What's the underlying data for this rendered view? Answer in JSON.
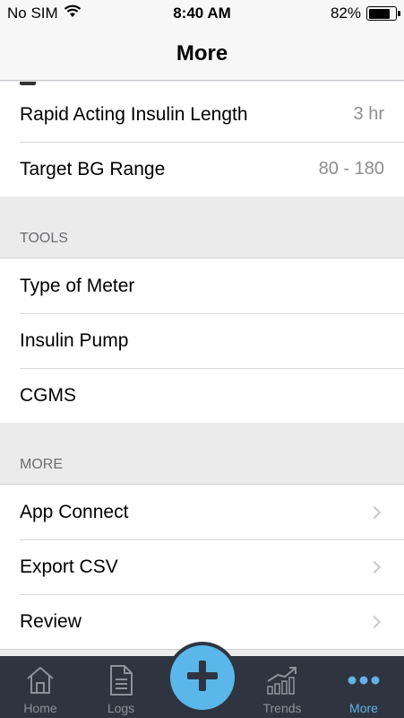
{
  "status_bar": {
    "carrier": "No SIM",
    "time": "8:40 AM",
    "battery_percent": "82%",
    "battery_level": 0.82
  },
  "nav": {
    "title": "More"
  },
  "settings": [
    {
      "label": "Rapid Acting Insulin Length",
      "value": "3 hr"
    },
    {
      "label": "Target BG Range",
      "value": "80 - 180"
    }
  ],
  "tools": {
    "header": "TOOLS",
    "items": [
      {
        "label": "Type of Meter"
      },
      {
        "label": "Insulin Pump"
      },
      {
        "label": "CGMS"
      }
    ]
  },
  "more": {
    "header": "MORE",
    "items": [
      {
        "label": "App Connect"
      },
      {
        "label": "Export CSV"
      },
      {
        "label": "Review"
      }
    ]
  },
  "tab_bar": {
    "tabs": [
      {
        "label": "Home",
        "icon": "home-icon"
      },
      {
        "label": "Logs",
        "icon": "document-icon"
      },
      {
        "label": "",
        "icon": "plus-icon"
      },
      {
        "label": "Trends",
        "icon": "trends-icon"
      },
      {
        "label": "More",
        "icon": "more-dots-icon",
        "active": true
      }
    ],
    "active_color": "#62b2e4",
    "inactive_color": "#8c929a",
    "background": "#2e3540",
    "fab_color": "#5bb6ea"
  }
}
